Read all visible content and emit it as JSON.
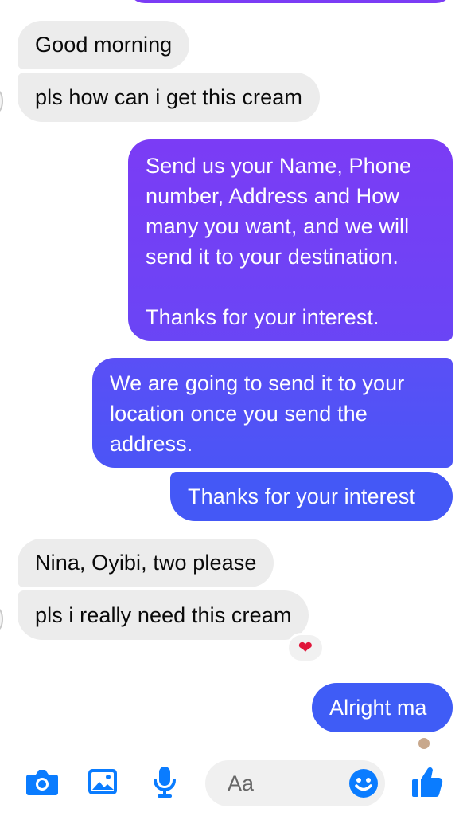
{
  "conversation": {
    "messages": [
      {
        "id": "m1",
        "direction": "incoming",
        "text": "Good morning"
      },
      {
        "id": "m2",
        "direction": "incoming",
        "text": "pls how can i get this cream"
      },
      {
        "id": "m3",
        "direction": "outgoing",
        "lines": [
          "Send us your Name, Phone",
          "number, Address and How",
          "many you want, and we will",
          "send it to your destination.",
          "",
          "Thanks for your interest."
        ]
      },
      {
        "id": "m4",
        "direction": "outgoing",
        "lines": [
          "We are going to send it to your",
          "location once you send the",
          "address."
        ]
      },
      {
        "id": "m5",
        "direction": "outgoing",
        "text": "Thanks for your interest"
      },
      {
        "id": "m6",
        "direction": "incoming",
        "text": "Nina, Oyibi, two please"
      },
      {
        "id": "m7",
        "direction": "incoming",
        "text": "pls i really need this cream",
        "reaction": "❤"
      },
      {
        "id": "m8",
        "direction": "outgoing",
        "text": "Alright ma"
      }
    ]
  },
  "composer": {
    "placeholder": "Aa"
  },
  "toolbar": {
    "icons": [
      "camera-icon",
      "image-icon",
      "microphone-icon",
      "emoji-icon",
      "thumbs-up-icon"
    ],
    "accent": "#0a7cff"
  },
  "colors": {
    "incoming_bubble": "#ececec",
    "outgoing_gradient_top": "#7b3cf5",
    "outgoing_gradient_bottom": "#3b5cf6"
  }
}
